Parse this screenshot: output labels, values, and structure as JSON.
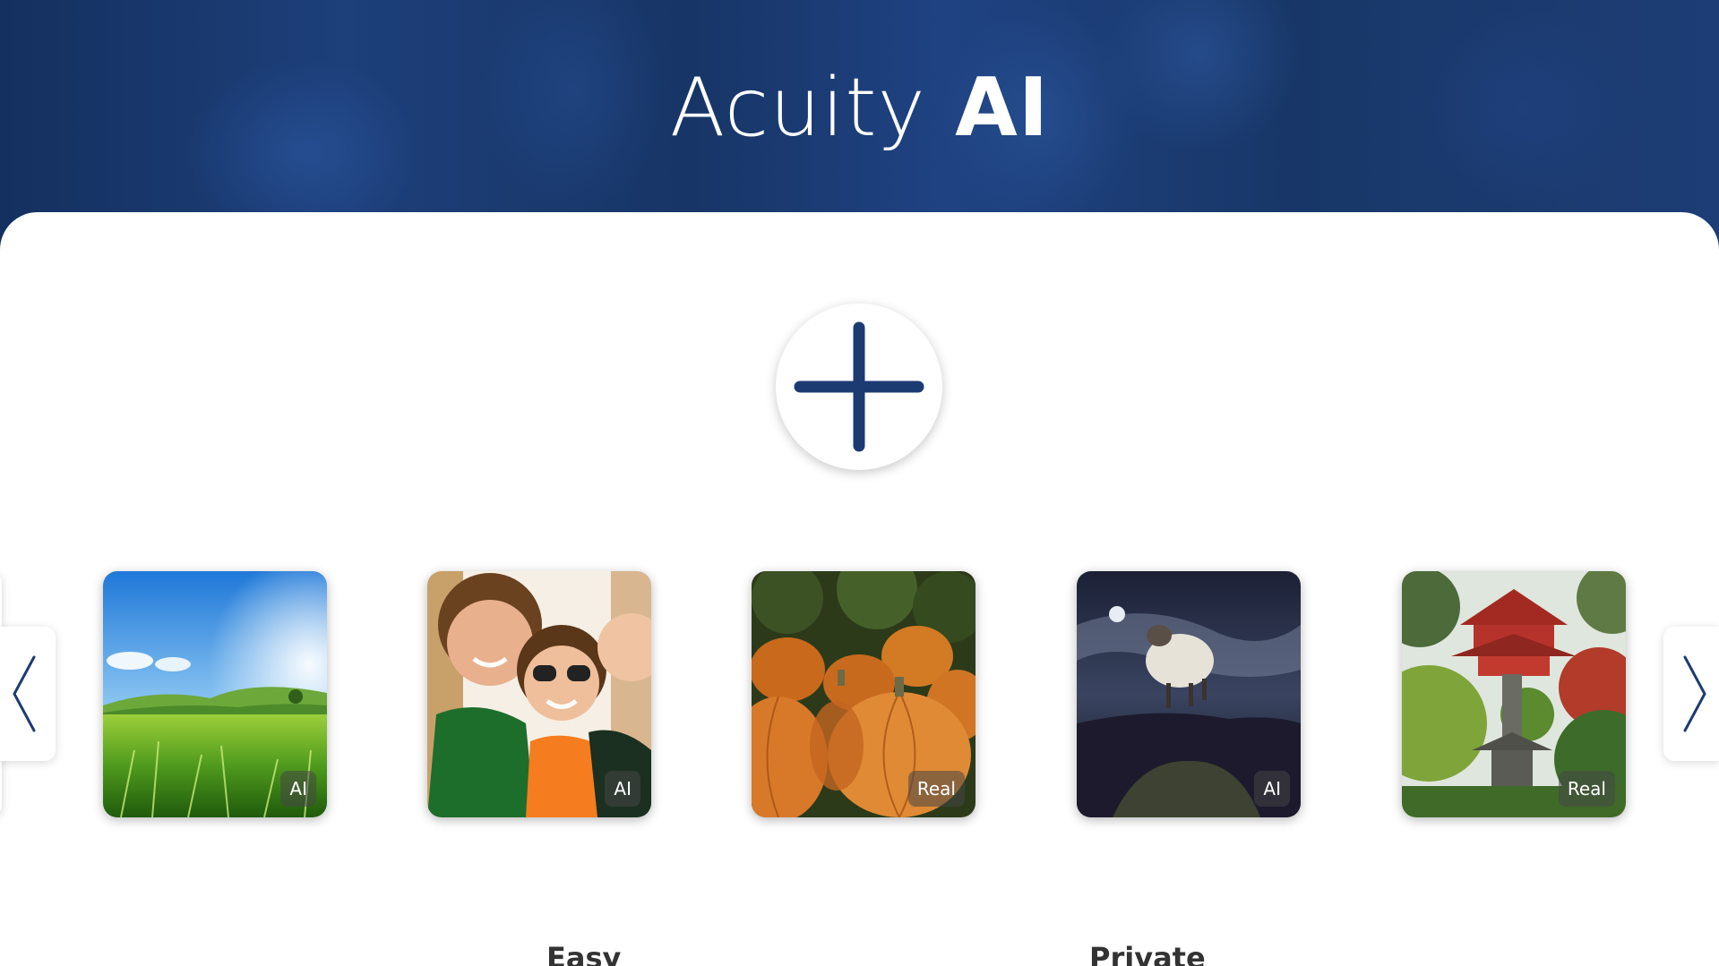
{
  "header": {
    "title_light": "Acuity",
    "title_bold": "AI"
  },
  "upload": {
    "icon": "plus-icon"
  },
  "carousel": {
    "prev_icon": "chevron-left-icon",
    "next_icon": "chevron-right-icon",
    "items": [
      {
        "subject": "green wheat field and hills under blue sky",
        "badge": "AI"
      },
      {
        "subject": "group of smiling teenagers",
        "badge": "AI"
      },
      {
        "subject": "pile of orange pumpkins",
        "badge": "Real"
      },
      {
        "subject": "sheep leaping under night sky with moon",
        "badge": "AI"
      },
      {
        "subject": "red pagoda and stone lantern in Japanese garden",
        "badge": "Real"
      }
    ]
  },
  "features": {
    "easy": "Easy",
    "private": "Private"
  },
  "colors": {
    "brand_navy": "#1a3a70",
    "accent": "#1d3b73",
    "badge_bg": "#464646"
  }
}
